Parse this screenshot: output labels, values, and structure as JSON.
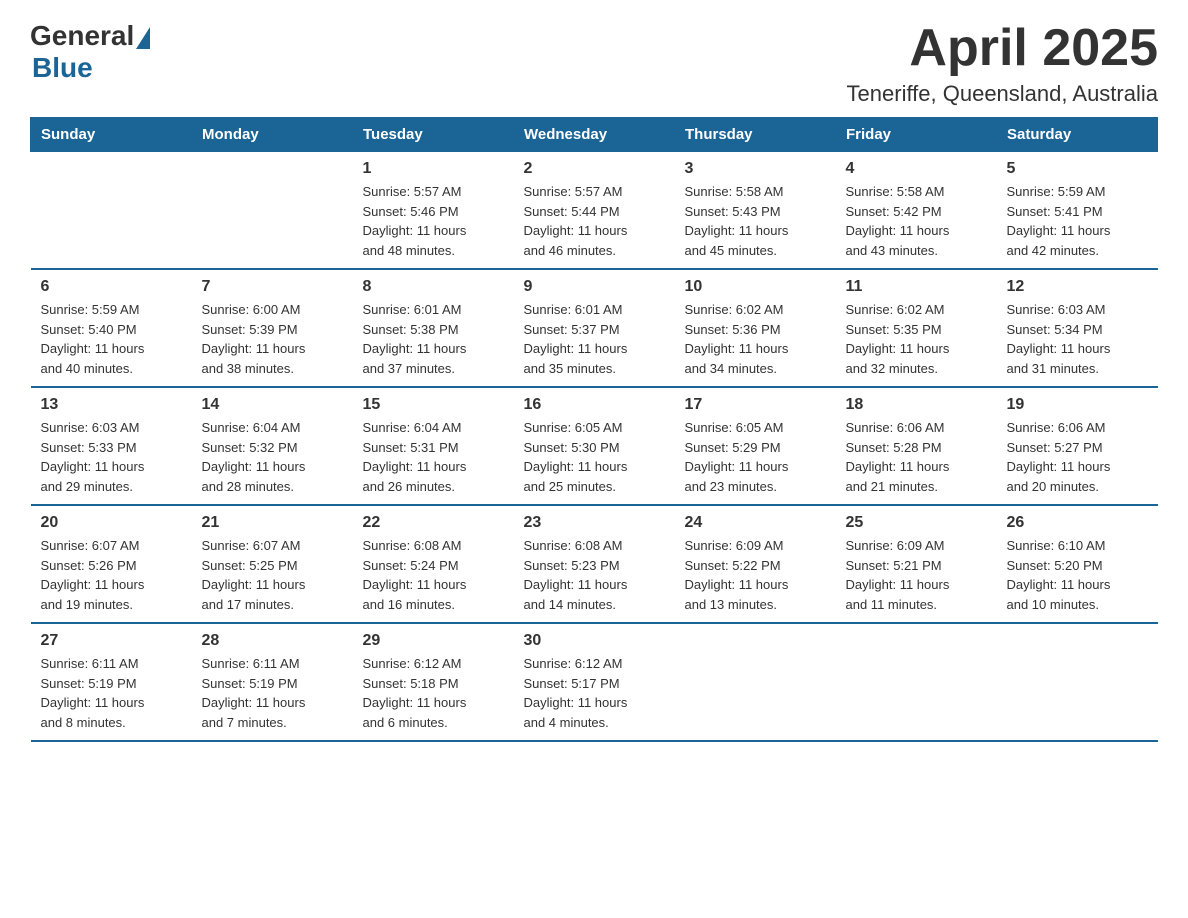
{
  "header": {
    "logo": {
      "general": "General",
      "blue": "Blue",
      "bottom": "Blue"
    },
    "month_title": "April 2025",
    "location": "Teneriffe, Queensland, Australia"
  },
  "calendar": {
    "days_of_week": [
      "Sunday",
      "Monday",
      "Tuesday",
      "Wednesday",
      "Thursday",
      "Friday",
      "Saturday"
    ],
    "weeks": [
      [
        {
          "day": "",
          "info": ""
        },
        {
          "day": "",
          "info": ""
        },
        {
          "day": "1",
          "info": "Sunrise: 5:57 AM\nSunset: 5:46 PM\nDaylight: 11 hours\nand 48 minutes."
        },
        {
          "day": "2",
          "info": "Sunrise: 5:57 AM\nSunset: 5:44 PM\nDaylight: 11 hours\nand 46 minutes."
        },
        {
          "day": "3",
          "info": "Sunrise: 5:58 AM\nSunset: 5:43 PM\nDaylight: 11 hours\nand 45 minutes."
        },
        {
          "day": "4",
          "info": "Sunrise: 5:58 AM\nSunset: 5:42 PM\nDaylight: 11 hours\nand 43 minutes."
        },
        {
          "day": "5",
          "info": "Sunrise: 5:59 AM\nSunset: 5:41 PM\nDaylight: 11 hours\nand 42 minutes."
        }
      ],
      [
        {
          "day": "6",
          "info": "Sunrise: 5:59 AM\nSunset: 5:40 PM\nDaylight: 11 hours\nand 40 minutes."
        },
        {
          "day": "7",
          "info": "Sunrise: 6:00 AM\nSunset: 5:39 PM\nDaylight: 11 hours\nand 38 minutes."
        },
        {
          "day": "8",
          "info": "Sunrise: 6:01 AM\nSunset: 5:38 PM\nDaylight: 11 hours\nand 37 minutes."
        },
        {
          "day": "9",
          "info": "Sunrise: 6:01 AM\nSunset: 5:37 PM\nDaylight: 11 hours\nand 35 minutes."
        },
        {
          "day": "10",
          "info": "Sunrise: 6:02 AM\nSunset: 5:36 PM\nDaylight: 11 hours\nand 34 minutes."
        },
        {
          "day": "11",
          "info": "Sunrise: 6:02 AM\nSunset: 5:35 PM\nDaylight: 11 hours\nand 32 minutes."
        },
        {
          "day": "12",
          "info": "Sunrise: 6:03 AM\nSunset: 5:34 PM\nDaylight: 11 hours\nand 31 minutes."
        }
      ],
      [
        {
          "day": "13",
          "info": "Sunrise: 6:03 AM\nSunset: 5:33 PM\nDaylight: 11 hours\nand 29 minutes."
        },
        {
          "day": "14",
          "info": "Sunrise: 6:04 AM\nSunset: 5:32 PM\nDaylight: 11 hours\nand 28 minutes."
        },
        {
          "day": "15",
          "info": "Sunrise: 6:04 AM\nSunset: 5:31 PM\nDaylight: 11 hours\nand 26 minutes."
        },
        {
          "day": "16",
          "info": "Sunrise: 6:05 AM\nSunset: 5:30 PM\nDaylight: 11 hours\nand 25 minutes."
        },
        {
          "day": "17",
          "info": "Sunrise: 6:05 AM\nSunset: 5:29 PM\nDaylight: 11 hours\nand 23 minutes."
        },
        {
          "day": "18",
          "info": "Sunrise: 6:06 AM\nSunset: 5:28 PM\nDaylight: 11 hours\nand 21 minutes."
        },
        {
          "day": "19",
          "info": "Sunrise: 6:06 AM\nSunset: 5:27 PM\nDaylight: 11 hours\nand 20 minutes."
        }
      ],
      [
        {
          "day": "20",
          "info": "Sunrise: 6:07 AM\nSunset: 5:26 PM\nDaylight: 11 hours\nand 19 minutes."
        },
        {
          "day": "21",
          "info": "Sunrise: 6:07 AM\nSunset: 5:25 PM\nDaylight: 11 hours\nand 17 minutes."
        },
        {
          "day": "22",
          "info": "Sunrise: 6:08 AM\nSunset: 5:24 PM\nDaylight: 11 hours\nand 16 minutes."
        },
        {
          "day": "23",
          "info": "Sunrise: 6:08 AM\nSunset: 5:23 PM\nDaylight: 11 hours\nand 14 minutes."
        },
        {
          "day": "24",
          "info": "Sunrise: 6:09 AM\nSunset: 5:22 PM\nDaylight: 11 hours\nand 13 minutes."
        },
        {
          "day": "25",
          "info": "Sunrise: 6:09 AM\nSunset: 5:21 PM\nDaylight: 11 hours\nand 11 minutes."
        },
        {
          "day": "26",
          "info": "Sunrise: 6:10 AM\nSunset: 5:20 PM\nDaylight: 11 hours\nand 10 minutes."
        }
      ],
      [
        {
          "day": "27",
          "info": "Sunrise: 6:11 AM\nSunset: 5:19 PM\nDaylight: 11 hours\nand 8 minutes."
        },
        {
          "day": "28",
          "info": "Sunrise: 6:11 AM\nSunset: 5:19 PM\nDaylight: 11 hours\nand 7 minutes."
        },
        {
          "day": "29",
          "info": "Sunrise: 6:12 AM\nSunset: 5:18 PM\nDaylight: 11 hours\nand 6 minutes."
        },
        {
          "day": "30",
          "info": "Sunrise: 6:12 AM\nSunset: 5:17 PM\nDaylight: 11 hours\nand 4 minutes."
        },
        {
          "day": "",
          "info": ""
        },
        {
          "day": "",
          "info": ""
        },
        {
          "day": "",
          "info": ""
        }
      ]
    ]
  }
}
